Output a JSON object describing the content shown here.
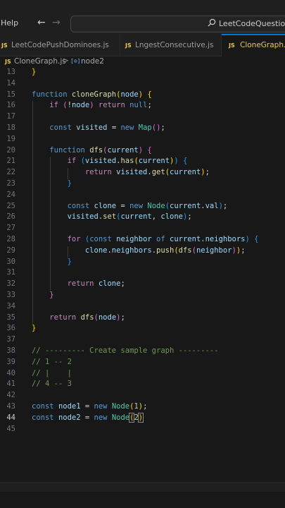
{
  "titlebar": {
    "menu_help": "Help",
    "back_arrow": "←",
    "forward_arrow": "→",
    "search_text": "LeetCodeQuestions"
  },
  "tabs": [
    {
      "icon": "JS",
      "label": "LeetCodePushDominoes.js",
      "active": false
    },
    {
      "icon": "JS",
      "label": "LngestConsecutive.js",
      "active": false
    },
    {
      "icon": "JS",
      "label": "CloneGraph.js",
      "active": true
    }
  ],
  "breadcrumb": {
    "icon": "JS",
    "file": "CloneGraph.js",
    "separator": ">",
    "symbol_icon": "[⊙]",
    "symbol": "node2"
  },
  "editor": {
    "current_line": "44",
    "lines": [
      {
        "n": "13",
        "tokens": [
          [
            "}",
            "br1"
          ]
        ]
      },
      {
        "n": "14",
        "tokens": []
      },
      {
        "n": "15",
        "tokens": [
          [
            "function ",
            "kw"
          ],
          [
            "cloneGraph",
            "fn"
          ],
          [
            "(",
            "br1"
          ],
          [
            "node",
            "var"
          ],
          [
            ")",
            "br1"
          ],
          [
            " ",
            "pun"
          ],
          [
            "{",
            "br1"
          ]
        ]
      },
      {
        "n": "16",
        "tokens": [
          [
            "    ",
            "pun"
          ],
          [
            "if",
            "ctrl"
          ],
          [
            " ",
            "pun"
          ],
          [
            "(",
            "br2"
          ],
          [
            "!",
            "pun"
          ],
          [
            "node",
            "var"
          ],
          [
            ")",
            "br2"
          ],
          [
            " ",
            "pun"
          ],
          [
            "return",
            "ctrl"
          ],
          [
            " ",
            "pun"
          ],
          [
            "null",
            "kw"
          ],
          [
            ";",
            "pun"
          ]
        ]
      },
      {
        "n": "17",
        "tokens": []
      },
      {
        "n": "18",
        "tokens": [
          [
            "    ",
            "pun"
          ],
          [
            "const ",
            "kw"
          ],
          [
            "visited",
            "var"
          ],
          [
            " = ",
            "pun"
          ],
          [
            "new ",
            "kw"
          ],
          [
            "Map",
            "cls"
          ],
          [
            "(",
            "br2"
          ],
          [
            ")",
            "br2"
          ],
          [
            ";",
            "pun"
          ]
        ]
      },
      {
        "n": "19",
        "tokens": []
      },
      {
        "n": "20",
        "tokens": [
          [
            "    ",
            "pun"
          ],
          [
            "function ",
            "kw"
          ],
          [
            "dfs",
            "fn"
          ],
          [
            "(",
            "br2"
          ],
          [
            "current",
            "var"
          ],
          [
            ")",
            "br2"
          ],
          [
            " ",
            "pun"
          ],
          [
            "{",
            "br2"
          ]
        ]
      },
      {
        "n": "21",
        "tokens": [
          [
            "        ",
            "pun"
          ],
          [
            "if",
            "ctrl"
          ],
          [
            " ",
            "pun"
          ],
          [
            "(",
            "br3"
          ],
          [
            "visited",
            "var"
          ],
          [
            ".",
            "pun"
          ],
          [
            "has",
            "fn"
          ],
          [
            "(",
            "br1"
          ],
          [
            "current",
            "var"
          ],
          [
            ")",
            "br1"
          ],
          [
            ")",
            "br3"
          ],
          [
            " ",
            "pun"
          ],
          [
            "{",
            "br3"
          ]
        ]
      },
      {
        "n": "22",
        "tokens": [
          [
            "            ",
            "pun"
          ],
          [
            "return",
            "ctrl"
          ],
          [
            " ",
            "pun"
          ],
          [
            "visited",
            "var"
          ],
          [
            ".",
            "pun"
          ],
          [
            "get",
            "fn"
          ],
          [
            "(",
            "br1"
          ],
          [
            "current",
            "var"
          ],
          [
            ")",
            "br1"
          ],
          [
            ";",
            "pun"
          ]
        ]
      },
      {
        "n": "23",
        "tokens": [
          [
            "        ",
            "pun"
          ],
          [
            "}",
            "br3"
          ]
        ]
      },
      {
        "n": "24",
        "tokens": []
      },
      {
        "n": "25",
        "tokens": [
          [
            "        ",
            "pun"
          ],
          [
            "const ",
            "kw"
          ],
          [
            "clone",
            "var"
          ],
          [
            " = ",
            "pun"
          ],
          [
            "new ",
            "kw"
          ],
          [
            "Node",
            "cls"
          ],
          [
            "(",
            "br3"
          ],
          [
            "current",
            "var"
          ],
          [
            ".",
            "pun"
          ],
          [
            "val",
            "var"
          ],
          [
            ")",
            "br3"
          ],
          [
            ";",
            "pun"
          ]
        ]
      },
      {
        "n": "26",
        "tokens": [
          [
            "        ",
            "pun"
          ],
          [
            "visited",
            "var"
          ],
          [
            ".",
            "pun"
          ],
          [
            "set",
            "fn"
          ],
          [
            "(",
            "br3"
          ],
          [
            "current",
            "var"
          ],
          [
            ", ",
            "pun"
          ],
          [
            "clone",
            "var"
          ],
          [
            ")",
            "br3"
          ],
          [
            ";",
            "pun"
          ]
        ]
      },
      {
        "n": "27",
        "tokens": []
      },
      {
        "n": "28",
        "tokens": [
          [
            "        ",
            "pun"
          ],
          [
            "for",
            "ctrl"
          ],
          [
            " ",
            "pun"
          ],
          [
            "(",
            "br3"
          ],
          [
            "const ",
            "kw"
          ],
          [
            "neighbor",
            "var"
          ],
          [
            " of ",
            "kw"
          ],
          [
            "current",
            "var"
          ],
          [
            ".",
            "pun"
          ],
          [
            "neighbors",
            "var"
          ],
          [
            ")",
            "br3"
          ],
          [
            " ",
            "pun"
          ],
          [
            "{",
            "br3"
          ]
        ]
      },
      {
        "n": "29",
        "tokens": [
          [
            "            ",
            "pun"
          ],
          [
            "clone",
            "var"
          ],
          [
            ".",
            "pun"
          ],
          [
            "neighbors",
            "var"
          ],
          [
            ".",
            "pun"
          ],
          [
            "push",
            "fn"
          ],
          [
            "(",
            "br1"
          ],
          [
            "dfs",
            "fn"
          ],
          [
            "(",
            "br2"
          ],
          [
            "neighbor",
            "var"
          ],
          [
            ")",
            "br2"
          ],
          [
            ")",
            "br1"
          ],
          [
            ";",
            "pun"
          ]
        ]
      },
      {
        "n": "30",
        "tokens": [
          [
            "        ",
            "pun"
          ],
          [
            "}",
            "br3"
          ]
        ]
      },
      {
        "n": "31",
        "tokens": []
      },
      {
        "n": "32",
        "tokens": [
          [
            "        ",
            "pun"
          ],
          [
            "return",
            "ctrl"
          ],
          [
            " ",
            "pun"
          ],
          [
            "clone",
            "var"
          ],
          [
            ";",
            "pun"
          ]
        ]
      },
      {
        "n": "33",
        "tokens": [
          [
            "    ",
            "pun"
          ],
          [
            "}",
            "br2"
          ]
        ]
      },
      {
        "n": "34",
        "tokens": []
      },
      {
        "n": "35",
        "tokens": [
          [
            "    ",
            "pun"
          ],
          [
            "return",
            "ctrl"
          ],
          [
            " ",
            "pun"
          ],
          [
            "dfs",
            "fn"
          ],
          [
            "(",
            "br2"
          ],
          [
            "node",
            "var"
          ],
          [
            ")",
            "br2"
          ],
          [
            ";",
            "pun"
          ]
        ]
      },
      {
        "n": "36",
        "tokens": [
          [
            "}",
            "br1"
          ]
        ]
      },
      {
        "n": "37",
        "tokens": []
      },
      {
        "n": "38",
        "tokens": [
          [
            "// --------- Create sample graph ---------",
            "cm"
          ]
        ]
      },
      {
        "n": "39",
        "tokens": [
          [
            "// 1 -- 2",
            "cm"
          ]
        ]
      },
      {
        "n": "40",
        "tokens": [
          [
            "// |    |",
            "cm"
          ]
        ]
      },
      {
        "n": "41",
        "tokens": [
          [
            "// 4 -- 3",
            "cm"
          ]
        ]
      },
      {
        "n": "42",
        "tokens": []
      },
      {
        "n": "43",
        "tokens": [
          [
            "const ",
            "kw"
          ],
          [
            "node1",
            "var"
          ],
          [
            " = ",
            "pun"
          ],
          [
            "new ",
            "kw"
          ],
          [
            "Node",
            "cls"
          ],
          [
            "(",
            "br1"
          ],
          [
            "1",
            "num"
          ],
          [
            ")",
            "br1"
          ],
          [
            ";",
            "pun"
          ]
        ]
      },
      {
        "n": "44",
        "tokens": [
          [
            "const ",
            "kw"
          ],
          [
            "node2",
            "var"
          ],
          [
            " = ",
            "pun"
          ],
          [
            "new ",
            "kw"
          ],
          [
            "Node",
            "cls"
          ],
          [
            "(",
            "br1 cursor-box"
          ],
          [
            "2",
            "num"
          ],
          [
            ")",
            "br1 cursor-box"
          ]
        ]
      },
      {
        "n": "45",
        "tokens": []
      }
    ]
  }
}
